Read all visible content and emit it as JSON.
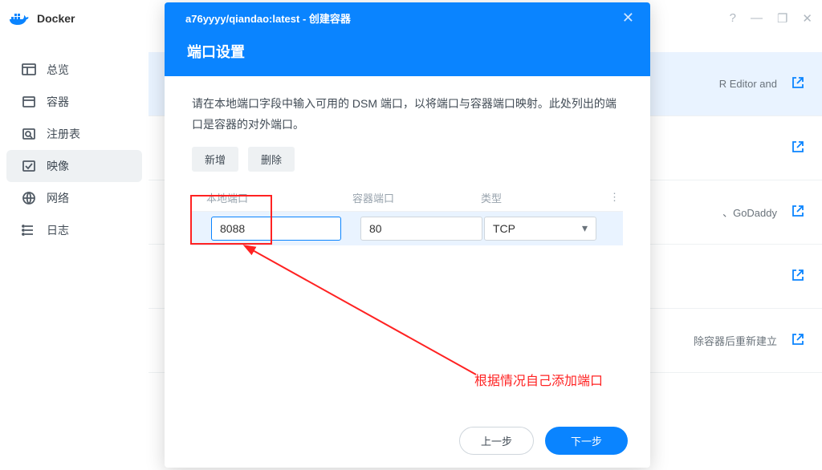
{
  "app": {
    "title": "Docker"
  },
  "window_actions": {
    "help": "?",
    "min": "—",
    "max": "❐",
    "close": "✕"
  },
  "sidebar": {
    "items": [
      {
        "label": "总览",
        "icon": "dashboard-icon"
      },
      {
        "label": "容器",
        "icon": "container-icon"
      },
      {
        "label": "注册表",
        "icon": "registry-icon"
      },
      {
        "label": "映像",
        "icon": "image-icon"
      },
      {
        "label": "网络",
        "icon": "network-icon"
      },
      {
        "label": "日志",
        "icon": "log-icon"
      }
    ],
    "active_index": 3
  },
  "background_rows": [
    {
      "text": "R Editor and"
    },
    {
      "text": ""
    },
    {
      "text": "、GoDaddy"
    },
    {
      "text": ""
    },
    {
      "text": "除容器后重新建立"
    }
  ],
  "modal": {
    "header_sub": "a76yyyy/qiandao:latest - 创建容器",
    "title": "端口设置",
    "desc": "请在本地端口字段中输入可用的 DSM 端口，以将端口与容器端口映射。此处列出的端口是容器的对外端口。",
    "buttons": {
      "add": "新增",
      "delete": "删除"
    },
    "table": {
      "headers": {
        "local": "本地端口",
        "container": "容器端口",
        "type": "类型"
      },
      "rows": [
        {
          "local": "8088",
          "container": "80",
          "type": "TCP"
        }
      ]
    },
    "annotation": "根据情况自己添加端口",
    "footer": {
      "back": "上一步",
      "next": "下一步"
    }
  }
}
